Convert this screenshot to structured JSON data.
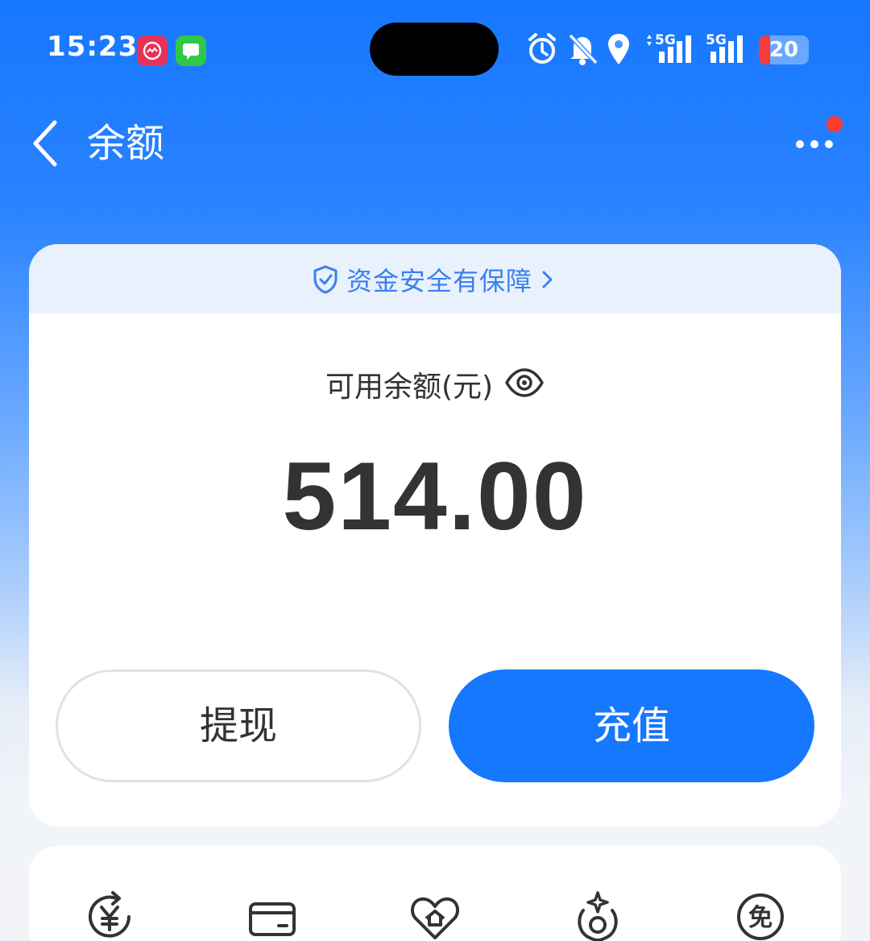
{
  "status_bar": {
    "time": "15:23",
    "network_1": "5G",
    "network_2": "5G",
    "battery": "20",
    "icons": [
      "app-badge-red",
      "messages-icon",
      "alarm-icon",
      "bell-off-icon",
      "location-icon",
      "signal-icon",
      "signal-icon"
    ],
    "colors": {
      "battery_low": "#f53b3b"
    }
  },
  "nav": {
    "title": "余额",
    "back_icon": "chevron-left-icon",
    "more_icon": "more-icon",
    "has_notification_dot": true
  },
  "balance_card": {
    "security_text": "资金安全有保障",
    "balance_label": "可用余额(元)",
    "balance_amount": "514.00",
    "withdraw_label": "提现",
    "recharge_label": "充值"
  },
  "services": {
    "icons": [
      "yuan-refresh-icon",
      "card-icon",
      "heart-home-icon",
      "sparkle-hand-icon",
      "free-badge-icon"
    ]
  },
  "colors": {
    "primary": "#1677ff",
    "text": "#333333",
    "banner_bg": "#e9f1fd",
    "banner_text": "#3a7ff0"
  }
}
